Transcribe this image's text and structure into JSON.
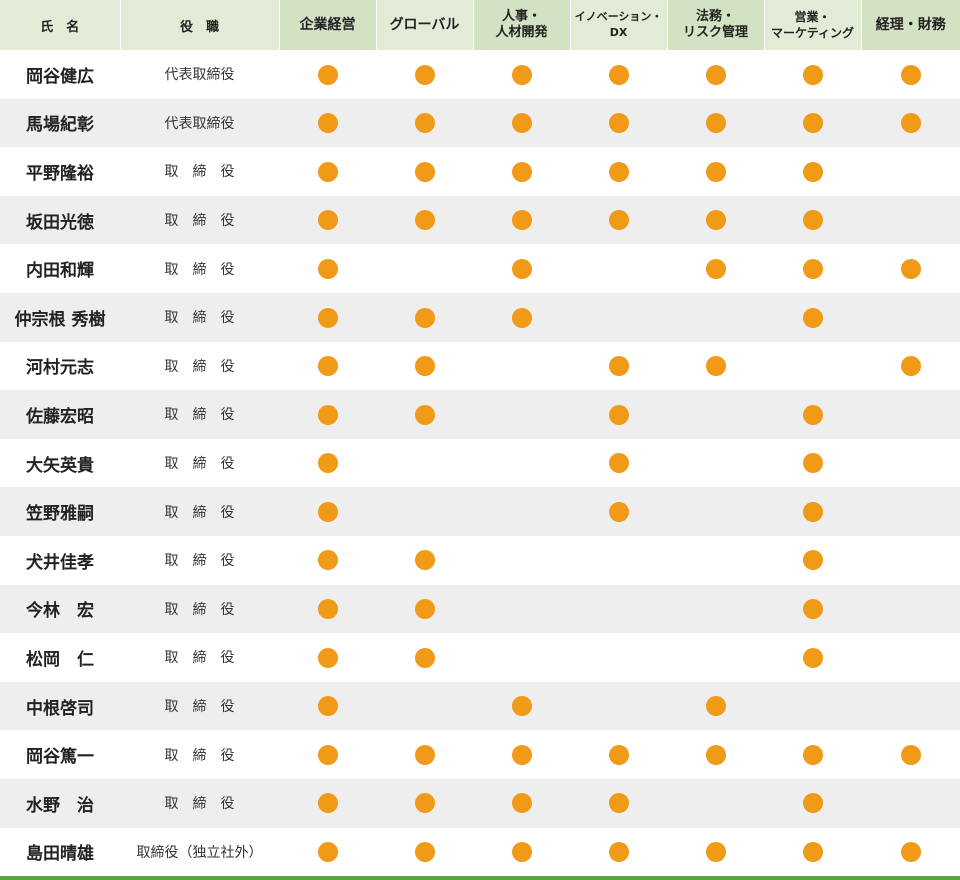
{
  "header": {
    "name": "氏　名",
    "role": "役　職",
    "skills": [
      {
        "lines": [
          "企業経営"
        ]
      },
      {
        "lines": [
          "グローバル"
        ]
      },
      {
        "lines": [
          "人事・",
          "人材開発"
        ]
      },
      {
        "lines": [
          "イノベーション・",
          "DX"
        ]
      },
      {
        "lines": [
          "法務・",
          "リスク管理"
        ]
      },
      {
        "lines": [
          "営業・",
          "マーケティング"
        ]
      },
      {
        "lines": [
          "経理・財務"
        ]
      }
    ]
  },
  "rows": [
    {
      "name": "岡谷健広",
      "role": "代表取締役",
      "skills": [
        1,
        1,
        1,
        1,
        1,
        1,
        1
      ]
    },
    {
      "name": "馬場紀彰",
      "role": "代表取締役",
      "skills": [
        1,
        1,
        1,
        1,
        1,
        1,
        1
      ]
    },
    {
      "name": "平野隆裕",
      "role": "取　締　役",
      "skills": [
        1,
        1,
        1,
        1,
        1,
        1,
        0
      ]
    },
    {
      "name": "坂田光徳",
      "role": "取　締　役",
      "skills": [
        1,
        1,
        1,
        1,
        1,
        1,
        0
      ]
    },
    {
      "name": "内田和輝",
      "role": "取　締　役",
      "skills": [
        1,
        0,
        1,
        0,
        1,
        1,
        1
      ]
    },
    {
      "name": "仲宗根 秀樹",
      "role": "取　締　役",
      "skills": [
        1,
        1,
        1,
        0,
        0,
        1,
        0
      ]
    },
    {
      "name": "河村元志",
      "role": "取　締　役",
      "skills": [
        1,
        1,
        0,
        1,
        1,
        0,
        1
      ]
    },
    {
      "name": "佐藤宏昭",
      "role": "取　締　役",
      "skills": [
        1,
        1,
        0,
        1,
        0,
        1,
        0
      ]
    },
    {
      "name": "大矢英貴",
      "role": "取　締　役",
      "skills": [
        1,
        0,
        0,
        1,
        0,
        1,
        0
      ]
    },
    {
      "name": "笠野雅嗣",
      "role": "取　締　役",
      "skills": [
        1,
        0,
        0,
        1,
        0,
        1,
        0
      ]
    },
    {
      "name": "犬井佳孝",
      "role": "取　締　役",
      "skills": [
        1,
        1,
        0,
        0,
        0,
        1,
        0
      ]
    },
    {
      "name": "今林　宏",
      "role": "取　締　役",
      "skills": [
        1,
        1,
        0,
        0,
        0,
        1,
        0
      ]
    },
    {
      "name": "松岡　仁",
      "role": "取　締　役",
      "skills": [
        1,
        1,
        0,
        0,
        0,
        1,
        0
      ]
    },
    {
      "name": "中根啓司",
      "role": "取　締　役",
      "skills": [
        1,
        0,
        1,
        0,
        1,
        0,
        0
      ]
    },
    {
      "name": "岡谷篤一",
      "role": "取　締　役",
      "skills": [
        1,
        1,
        1,
        1,
        1,
        1,
        1
      ]
    },
    {
      "name": "水野　治",
      "role": "取　締　役",
      "skills": [
        1,
        1,
        1,
        1,
        0,
        1,
        0
      ]
    },
    {
      "name": "島田晴雄",
      "role": "取締役（独立社外）",
      "skills": [
        1,
        1,
        1,
        1,
        1,
        1,
        1
      ]
    }
  ],
  "colors": {
    "dot": "#f09a17",
    "header_light": "#e2ebd6",
    "header_dark": "#d3e2c3",
    "row_stripe": "#eeeeee",
    "bottom_rule": "#5aa83c"
  }
}
